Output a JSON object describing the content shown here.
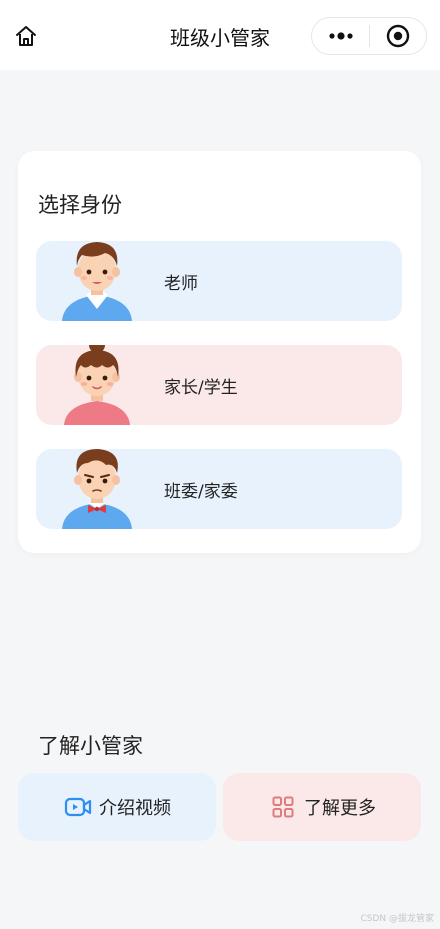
{
  "navbar": {
    "title": "班级小管家",
    "icons": [
      "home-icon",
      "more-dots-icon",
      "close-circle-icon"
    ]
  },
  "identity": {
    "title": "选择身份",
    "roles": [
      {
        "label": "老师",
        "color": "#e7f2fd",
        "avatar": "teacher-avatar"
      },
      {
        "label": "家长/学生",
        "color": "#fbe9ea",
        "avatar": "parent-student-avatar"
      },
      {
        "label": "班委/家委",
        "color": "#e7f2fd",
        "avatar": "committee-avatar"
      }
    ]
  },
  "learn": {
    "title": "了解小管家",
    "video_label": "介绍视频",
    "more_label": "了解更多"
  },
  "colors": {
    "accent_blue": "#2c8ef0",
    "accent_red": "#e37a7a",
    "background": "#f5f6f8"
  },
  "watermark": "CSDN @拔龙管家"
}
